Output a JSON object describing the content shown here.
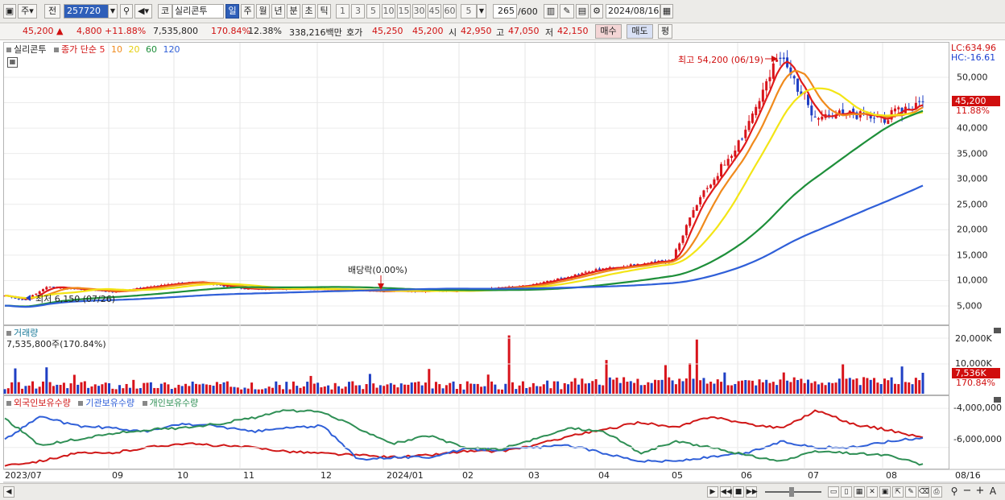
{
  "toolbar": {
    "period_primary": "주",
    "compare_label": "전",
    "stock_code": "257720",
    "market_badge": "코",
    "stock_name": "실리콘투",
    "periods": [
      "일",
      "주",
      "월",
      "년",
      "분",
      "초",
      "틱"
    ],
    "period_selected": "일",
    "intervals": [
      "1",
      "3",
      "5",
      "10",
      "15",
      "30",
      "45",
      "60"
    ],
    "interval_select": "5",
    "count": "265",
    "count_total": "/600",
    "date": "2024/08/16"
  },
  "info": {
    "price": "45,200",
    "change": "4,800",
    "change_pct": "+11.88%",
    "volume": "7,535,800",
    "volume_ratio": "170.84%",
    "turnover": "12.38%",
    "amount": "338,216백만",
    "quote_label": "호가",
    "ask": "45,250",
    "bid": "45,200",
    "open_label": "시",
    "open": "42,950",
    "high_label": "고",
    "high": "47,050",
    "low_label": "저",
    "low": "42,150",
    "buy_label": "매수",
    "sell_label": "매도",
    "eval_label": "평"
  },
  "price_pane": {
    "legend_name": "실리콘투",
    "legend_type": "종가 단순",
    "ma_periods": [
      "5",
      "10",
      "20",
      "60",
      "120"
    ],
    "ma_colors": [
      "#e01b1b",
      "#f08a1c",
      "#f3e516",
      "#1e8f3a",
      "#2f5fd8"
    ],
    "lc": "LC:634.96",
    "hc": "HC:-16.61",
    "annot_high": "최고 54,200 (06/19)",
    "annot_low": "최저 6,150 (07/26)",
    "annot_dividend": "배당락(0.00%)",
    "current_tag": "45,200",
    "current_pct": "11.88%",
    "y_ticks": [
      "50,000",
      "45,000",
      "40,000",
      "35,000",
      "30,000",
      "25,000",
      "20,000",
      "15,000",
      "10,000",
      "5,000"
    ]
  },
  "volume_pane": {
    "title": "거래량",
    "value": "7,535,800주(170.84%)",
    "y_ticks": [
      "20,000K",
      "10,000K"
    ],
    "current_tag": "7,536K",
    "current_pct": "170.84%"
  },
  "holdings_pane": {
    "series_labels": [
      "외국인보유수량",
      "기관보유수량",
      "개인보유수량"
    ],
    "y_ticks": [
      "-4,000,000",
      "-6,000,000"
    ]
  },
  "x_axis": {
    "labels": [
      "2023/07",
      "09",
      "10",
      "11",
      "12",
      "2024/01",
      "02",
      "03",
      "04",
      "05",
      "06",
      "07",
      "08",
      "08/16"
    ]
  },
  "chart_data": {
    "type": "candlestick",
    "title": "실리콘투",
    "x_range": [
      "2023/07",
      "2024/08/16"
    ],
    "ylim": [
      2000,
      56000
    ],
    "price_anchors": [
      {
        "x": "2023/07",
        "close": 7000
      },
      {
        "x": "2023/07/26",
        "close": 6150
      },
      {
        "x": "2023/08",
        "close": 8800
      },
      {
        "x": "2023/09",
        "close": 7800
      },
      {
        "x": "2023/10",
        "close": 9800
      },
      {
        "x": "2023/11",
        "close": 8400
      },
      {
        "x": "2023/12",
        "close": 8300
      },
      {
        "x": "2024/01",
        "close": 7900
      },
      {
        "x": "2024/02",
        "close": 8000
      },
      {
        "x": "2024/03",
        "close": 9000
      },
      {
        "x": "2024/04",
        "close": 12200
      },
      {
        "x": "2024/05",
        "close": 14000
      },
      {
        "x": "2024/05/20",
        "close": 25000
      },
      {
        "x": "2024/06",
        "close": 38000
      },
      {
        "x": "2024/06/19",
        "close": 54200
      },
      {
        "x": "2024/07",
        "close": 43000
      },
      {
        "x": "2024/08",
        "close": 42000
      },
      {
        "x": "2024/08/16",
        "close": 45200
      }
    ],
    "moving_averages": [
      "5",
      "10",
      "20",
      "60",
      "120"
    ],
    "volume_ylim": [
      0,
      24000
    ],
    "volume_unit": "K",
    "volume_last": 7536,
    "holdings_series": [
      "외국인보유수량",
      "기관보유수량",
      "개인보유수량"
    ],
    "holdings_colors": [
      "#d01818",
      "#2f5fd8",
      "#2f8f55"
    ],
    "holdings_ylim": [
      -7000000,
      -3500000
    ]
  }
}
